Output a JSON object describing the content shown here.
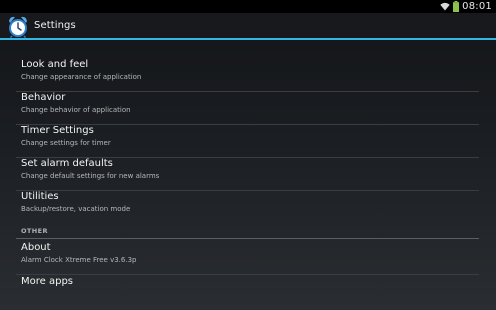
{
  "status_bar": {
    "time": "08:01"
  },
  "action_bar": {
    "title": "Settings",
    "app_icon": "alarm-clock-icon"
  },
  "settings": [
    {
      "title": "Look and feel",
      "subtitle": "Change appearance of application"
    },
    {
      "title": "Behavior",
      "subtitle": "Change behavior of application"
    },
    {
      "title": "Timer Settings",
      "subtitle": "Change settings for timer"
    },
    {
      "title": "Set alarm defaults",
      "subtitle": "Change default settings for new alarms"
    },
    {
      "title": "Utilities",
      "subtitle": "Backup/restore, vacation mode"
    }
  ],
  "other_section": {
    "header": "OTHER",
    "items": [
      {
        "title": "About",
        "subtitle": "Alarm Clock Xtreme Free v3.6.3p"
      },
      {
        "title": "More apps"
      }
    ]
  },
  "colors": {
    "accent": "#33b5e5",
    "battery": "#8bc34a"
  }
}
